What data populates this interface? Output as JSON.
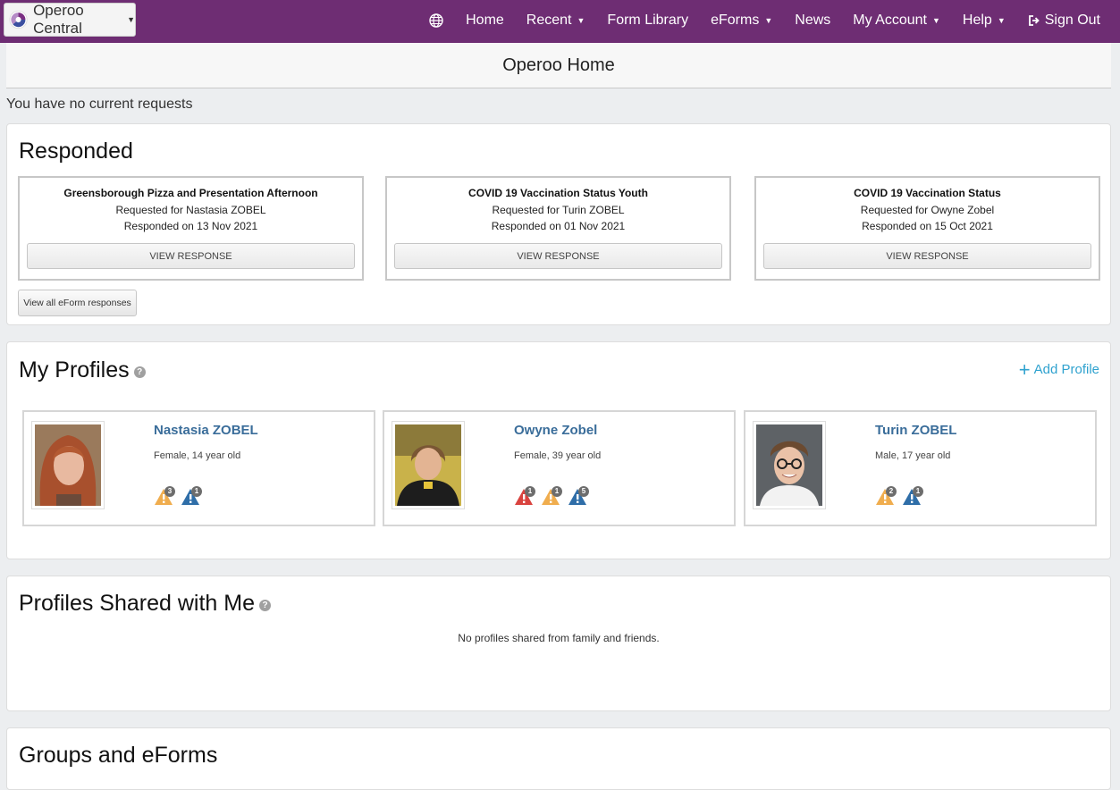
{
  "navbar": {
    "brand": "Operoo Central",
    "items": [
      {
        "label": "Home",
        "dropdown": false
      },
      {
        "label": "Recent",
        "dropdown": true
      },
      {
        "label": "Form Library",
        "dropdown": false
      },
      {
        "label": "eForms",
        "dropdown": true
      },
      {
        "label": "News",
        "dropdown": false
      },
      {
        "label": "My Account",
        "dropdown": true
      },
      {
        "label": "Help",
        "dropdown": true
      },
      {
        "label": "Sign Out",
        "dropdown": false
      }
    ],
    "bg_color": "#6e2d73"
  },
  "page_title": "Operoo Home",
  "no_requests": "You have no current requests",
  "responded": {
    "title": "Responded",
    "cards": [
      {
        "title": "Greensborough Pizza and Presentation Afternoon",
        "requested_for": "Requested for Nastasia ZOBEL",
        "responded_on": "Responded on 13 Nov 2021",
        "button": "VIEW RESPONSE"
      },
      {
        "title": "COVID 19 Vaccination Status Youth",
        "requested_for": "Requested for Turin ZOBEL",
        "responded_on": "Responded on 01 Nov 2021",
        "button": "VIEW RESPONSE"
      },
      {
        "title": "COVID 19 Vaccination Status",
        "requested_for": "Requested for Owyne Zobel",
        "responded_on": "Responded on 15 Oct 2021",
        "button": "VIEW RESPONSE"
      }
    ],
    "view_all": "View all eForm responses"
  },
  "my_profiles": {
    "title": "My Profiles",
    "add_label": "Add Profile",
    "accent_color": "#2fa2cf",
    "profiles": [
      {
        "name": "Nastasia ZOBEL",
        "info": "Female, 14 year old",
        "badges": [
          {
            "type": "warning-orange",
            "count": "3"
          },
          {
            "type": "alert-blue",
            "count": "1"
          }
        ]
      },
      {
        "name": "Owyne Zobel",
        "info": "Female, 39 year old",
        "badges": [
          {
            "type": "alert-red",
            "count": "1"
          },
          {
            "type": "warning-orange",
            "count": "1"
          },
          {
            "type": "alert-blue",
            "count": "5"
          }
        ]
      },
      {
        "name": "Turin ZOBEL",
        "info": "Male, 17 year old",
        "badges": [
          {
            "type": "warning-orange",
            "count": "2"
          },
          {
            "type": "alert-blue",
            "count": "1"
          }
        ]
      }
    ]
  },
  "shared": {
    "title": "Profiles Shared with Me",
    "empty": "No profiles shared from family and friends."
  },
  "groups": {
    "title": "Groups and eForms"
  }
}
